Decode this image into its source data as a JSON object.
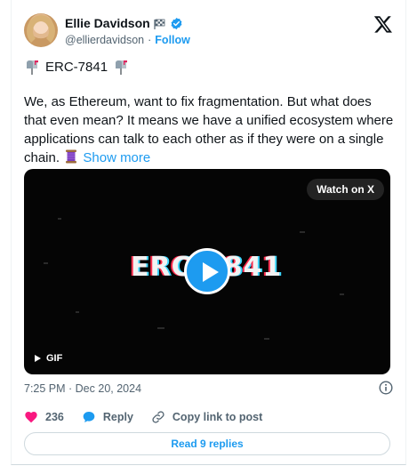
{
  "author": {
    "name": "Ellie Davidson",
    "handle": "@ellierdavidson",
    "separator": "·",
    "follow_label": "Follow"
  },
  "icons": {
    "flag": "checkered-flag-icon",
    "verified": "verified-badge-icon",
    "brand": "x-logo-icon",
    "title_left": "mailbox-icon",
    "title_right": "mailbox-icon",
    "inline": "thread-spool-icon",
    "info": "info-icon",
    "like": "heart-icon",
    "reply": "reply-bubble-icon",
    "copy": "link-icon"
  },
  "tweet": {
    "title": "ERC-7841",
    "body": "We, as Ethereum, want to fix fragmentation. But what does that even mean? It means we have a unified ecosystem where applications can talk to each other as if they were on a single chain.",
    "show_more": "Show more"
  },
  "media": {
    "watch_label": "Watch on X",
    "overlay_text": "ERC-7841",
    "gif_label": "GIF"
  },
  "meta": {
    "timestamp": "7:25 PM · Dec 20, 2024"
  },
  "actions": {
    "like_count": "236",
    "reply_label": "Reply",
    "copy_label": "Copy link to post"
  },
  "footer": {
    "read_replies_label": "Read 9 replies"
  },
  "colors": {
    "accent": "#1d9bf0",
    "like": "#f91880",
    "text": "#0f1419",
    "muted": "#536471"
  }
}
